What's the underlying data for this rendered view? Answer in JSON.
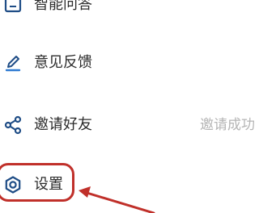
{
  "menu": {
    "items": [
      {
        "label": "智能问答",
        "icon": "chat-box-icon"
      },
      {
        "label": "意见反馈",
        "icon": "pencil-icon"
      },
      {
        "label": "邀请好友",
        "icon": "share-icon",
        "hint": "邀请成功"
      },
      {
        "label": "设置",
        "icon": "gear-icon"
      }
    ]
  },
  "annotation": {
    "color": "#c0302a",
    "target": "设置"
  },
  "colors": {
    "icon": "#1f4d86",
    "pencil_underline": "#2e7ad1",
    "label": "#2b2b2b",
    "hint": "#b5b5b5"
  }
}
